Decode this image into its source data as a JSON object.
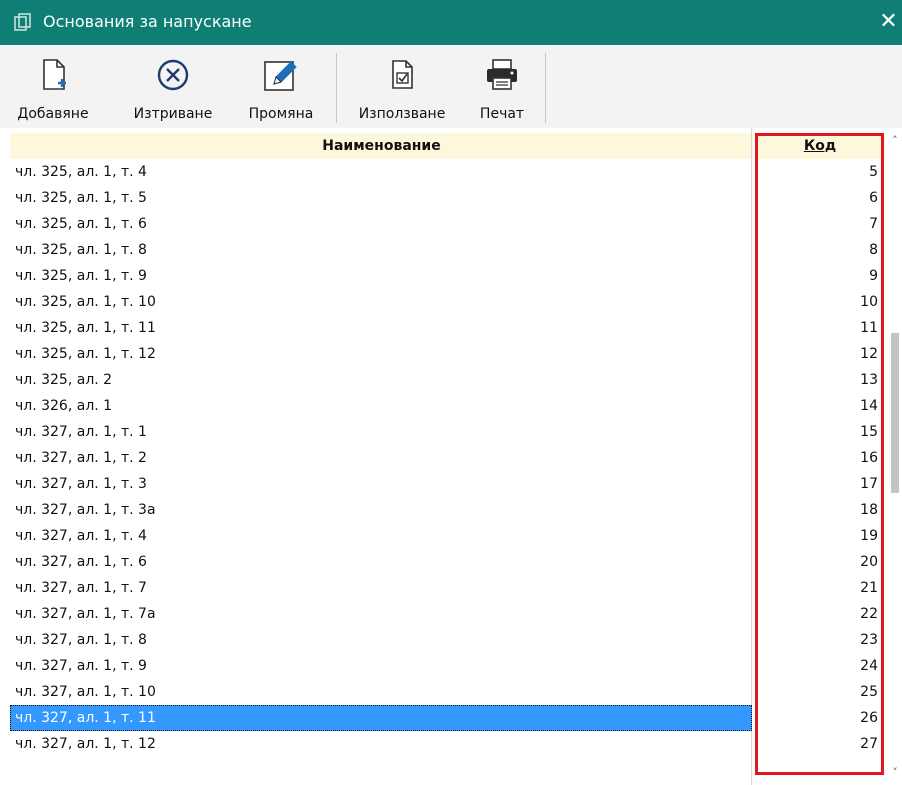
{
  "window": {
    "title": "Основания за напускане",
    "close_symbol": "✕"
  },
  "toolbar": {
    "add_label": "Добавяне",
    "delete_label": "Изтриване",
    "edit_label": "Промяна",
    "use_label": "Използване",
    "print_label": "Печат"
  },
  "grid": {
    "columns": {
      "name": "Наименование",
      "code": "Код"
    },
    "rows": [
      {
        "name": "чл. 325, ал. 1, т. 4",
        "code": "5"
      },
      {
        "name": "чл. 325, ал. 1, т. 5",
        "code": "6"
      },
      {
        "name": "чл. 325, ал. 1, т. 6",
        "code": "7"
      },
      {
        "name": "чл. 325, ал. 1, т. 8",
        "code": "8"
      },
      {
        "name": "чл. 325, ал. 1, т. 9",
        "code": "9"
      },
      {
        "name": "чл. 325, ал. 1, т. 10",
        "code": "10"
      },
      {
        "name": "чл. 325, ал. 1, т. 11",
        "code": "11"
      },
      {
        "name": "чл. 325, ал. 1, т. 12",
        "code": "12"
      },
      {
        "name": "чл. 325, ал. 2",
        "code": "13"
      },
      {
        "name": "чл. 326, ал. 1",
        "code": "14"
      },
      {
        "name": "чл. 327, ал. 1, т. 1",
        "code": "15"
      },
      {
        "name": "чл. 327, ал. 1, т. 2",
        "code": "16"
      },
      {
        "name": "чл. 327, ал. 1, т. 3",
        "code": "17"
      },
      {
        "name": "чл. 327, ал. 1, т. 3а",
        "code": "18"
      },
      {
        "name": "чл. 327, ал. 1, т. 4",
        "code": "19"
      },
      {
        "name": "чл. 327, ал. 1, т. 6",
        "code": "20"
      },
      {
        "name": "чл. 327, ал. 1, т. 7",
        "code": "21"
      },
      {
        "name": "чл. 327, ал. 1, т. 7а",
        "code": "22"
      },
      {
        "name": "чл. 327, ал. 1, т. 8",
        "code": "23"
      },
      {
        "name": "чл. 327, ал. 1, т. 9",
        "code": "24"
      },
      {
        "name": "чл. 327, ал. 1, т. 10",
        "code": "25"
      },
      {
        "name": "чл. 327, ал. 1, т. 11",
        "code": "26",
        "selected": true
      },
      {
        "name": "чл. 327, ал. 1, т. 12",
        "code": "27"
      }
    ]
  },
  "colors": {
    "titlebar": "#0f7f76",
    "header_bg": "#fdf8dc",
    "selection": "#3399ff",
    "highlight_border": "#e0171f",
    "icon_blue": "#1e6fb8"
  },
  "icons": {
    "title": "copy-icon",
    "add": "new-document-icon",
    "delete": "circle-x-icon",
    "edit": "pencil-icon",
    "use": "checked-document-icon",
    "print": "printer-icon"
  }
}
